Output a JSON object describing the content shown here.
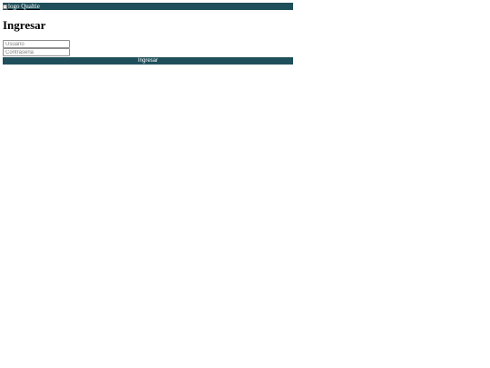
{
  "header": {
    "logo_alt": "logo Qualtie",
    "bar_color": "#1f4f5b"
  },
  "page": {
    "title": "Ingresar"
  },
  "form": {
    "username_placeholder": "Usuario",
    "password_placeholder": "Contraseña",
    "submit_label": "Ingresar"
  },
  "icons": {
    "broken_image": "broken-image-icon"
  }
}
